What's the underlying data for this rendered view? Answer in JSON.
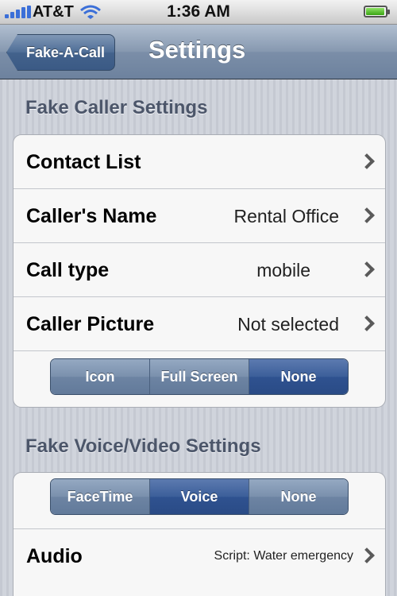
{
  "status_bar": {
    "carrier": "AT&T",
    "time": "1:36 AM"
  },
  "nav": {
    "back_label": "Fake-A-Call",
    "title": "Settings"
  },
  "fake_caller": {
    "header": "Fake Caller Settings",
    "rows": [
      {
        "label": "Contact List",
        "value": ""
      },
      {
        "label": "Caller's Name",
        "value": "Rental Office"
      },
      {
        "label": "Call type",
        "value": "mobile"
      },
      {
        "label": "Caller Picture",
        "value": "Not selected"
      }
    ],
    "picture_options": [
      "Icon",
      "Full Screen",
      "None"
    ],
    "picture_selected": "None"
  },
  "fake_voice": {
    "header": "Fake Voice/Video Settings",
    "mode_options": [
      "FaceTime",
      "Voice",
      "None"
    ],
    "mode_selected": "Voice",
    "audio_label": "Audio",
    "audio_value": "Script: Water emergency"
  },
  "colors": {
    "accent": "#2f5290",
    "nav_bar": "#7b8ea8",
    "background": "#c8ccd4"
  }
}
